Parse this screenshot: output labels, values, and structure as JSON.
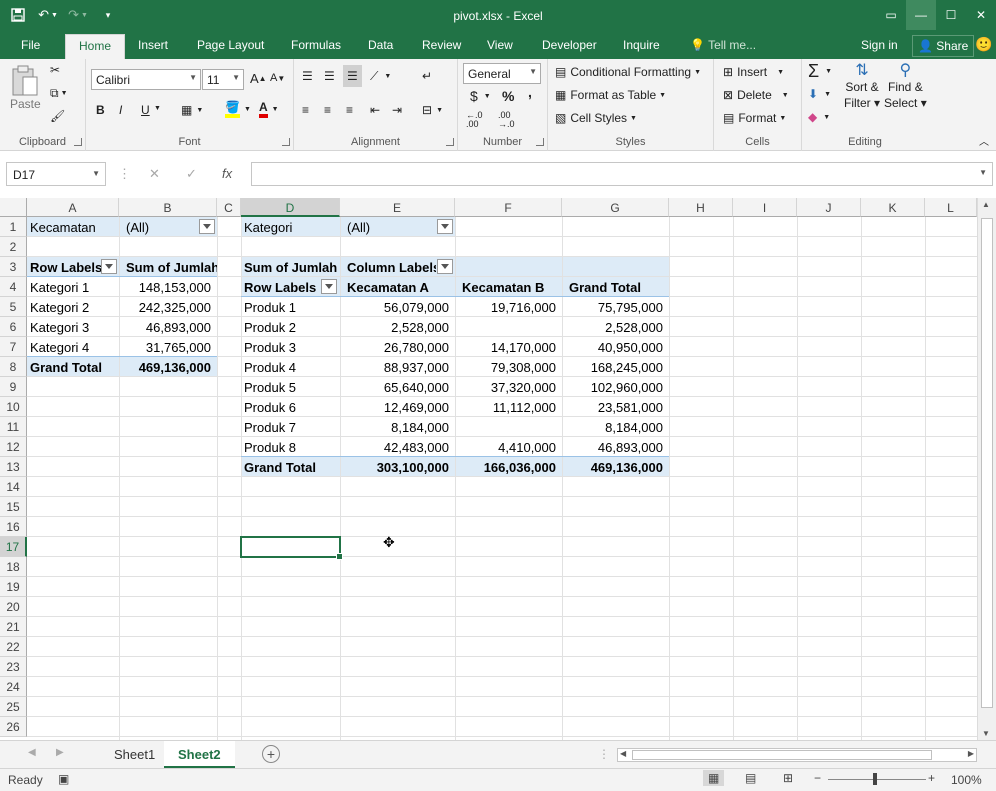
{
  "window": {
    "title": "pivot.xlsx - Excel"
  },
  "ribbon_tabs": [
    "File",
    "Home",
    "Insert",
    "Page Layout",
    "Formulas",
    "Data",
    "Review",
    "View",
    "Developer",
    "Inquire"
  ],
  "tell_me": "Tell me...",
  "account": {
    "sign_in": "Sign in",
    "share": "Share"
  },
  "clipboard": {
    "paste": "Paste",
    "label": "Clipboard"
  },
  "font": {
    "name": "Calibri",
    "size": "11",
    "bold": "B",
    "italic": "I",
    "underline": "U",
    "label": "Font"
  },
  "alignment": {
    "label": "Alignment"
  },
  "number": {
    "format": "General",
    "currency": "$",
    "percent": "%",
    "comma": ",",
    "inc_decimal": "←.0\n.00",
    "dec_decimal": ".00\n→.0",
    "label": "Number"
  },
  "styles": {
    "conditional": "Conditional Formatting",
    "format_table": "Format as Table",
    "cell_styles": "Cell Styles",
    "label": "Styles"
  },
  "cells_group": {
    "insert": "Insert",
    "delete": "Delete",
    "format": "Format",
    "label": "Cells"
  },
  "editing": {
    "sort_filter": "Sort &",
    "sort_filter2": "Filter",
    "find_select": "Find &",
    "find_select2": "Select",
    "label": "Editing"
  },
  "formula_bar": {
    "name_box": "D17",
    "cancel": "✕",
    "enter": "✓",
    "fx": "fx",
    "formula": ""
  },
  "columns": [
    "A",
    "B",
    "C",
    "D",
    "E",
    "F",
    "G",
    "H",
    "I",
    "J",
    "K",
    "L"
  ],
  "rows": [
    "1",
    "2",
    "3",
    "4",
    "5",
    "6",
    "7",
    "8",
    "9",
    "10",
    "11",
    "12",
    "13",
    "14",
    "15",
    "16",
    "17",
    "18",
    "19",
    "20",
    "21",
    "22",
    "23",
    "24",
    "25",
    "26"
  ],
  "pivot1": {
    "filter_label": "Kecamatan",
    "filter_value": "(All)",
    "row_labels": "Row Labels",
    "value_header": "Sum of Jumlah",
    "rows": [
      {
        "label": "Kategori 1",
        "value": "148,153,000"
      },
      {
        "label": "Kategori 2",
        "value": "242,325,000"
      },
      {
        "label": "Kategori 3",
        "value": "46,893,000"
      },
      {
        "label": "Kategori 4",
        "value": "31,765,000"
      }
    ],
    "grand_total_label": "Grand Total",
    "grand_total": "469,136,000"
  },
  "pivot2": {
    "filter_label": "Kategori",
    "filter_value": "(All)",
    "sum_header": "Sum of Jumlah",
    "column_labels": "Column Labels",
    "row_labels": "Row Labels",
    "col_a": "Kecamatan A",
    "col_b": "Kecamatan B",
    "col_total": "Grand Total",
    "rows": [
      {
        "label": "Produk 1",
        "a": "56,079,000",
        "b": "19,716,000",
        "total": "75,795,000"
      },
      {
        "label": "Produk 2",
        "a": "2,528,000",
        "b": "",
        "total": "2,528,000"
      },
      {
        "label": "Produk 3",
        "a": "26,780,000",
        "b": "14,170,000",
        "total": "40,950,000"
      },
      {
        "label": "Produk 4",
        "a": "88,937,000",
        "b": "79,308,000",
        "total": "168,245,000"
      },
      {
        "label": "Produk 5",
        "a": "65,640,000",
        "b": "37,320,000",
        "total": "102,960,000"
      },
      {
        "label": "Produk 6",
        "a": "12,469,000",
        "b": "11,112,000",
        "total": "23,581,000"
      },
      {
        "label": "Produk 7",
        "a": "8,184,000",
        "b": "",
        "total": "8,184,000"
      },
      {
        "label": "Produk 8",
        "a": "42,483,000",
        "b": "4,410,000",
        "total": "46,893,000"
      }
    ],
    "grand_total_label": "Grand Total",
    "grand_a": "303,100,000",
    "grand_b": "166,036,000",
    "grand_total": "469,136,000"
  },
  "sheets": [
    "Sheet1",
    "Sheet2"
  ],
  "status": {
    "ready": "Ready",
    "zoom": "100%"
  },
  "colors": {
    "brand": "#217346",
    "pivot_fill": "#ddebf7"
  }
}
